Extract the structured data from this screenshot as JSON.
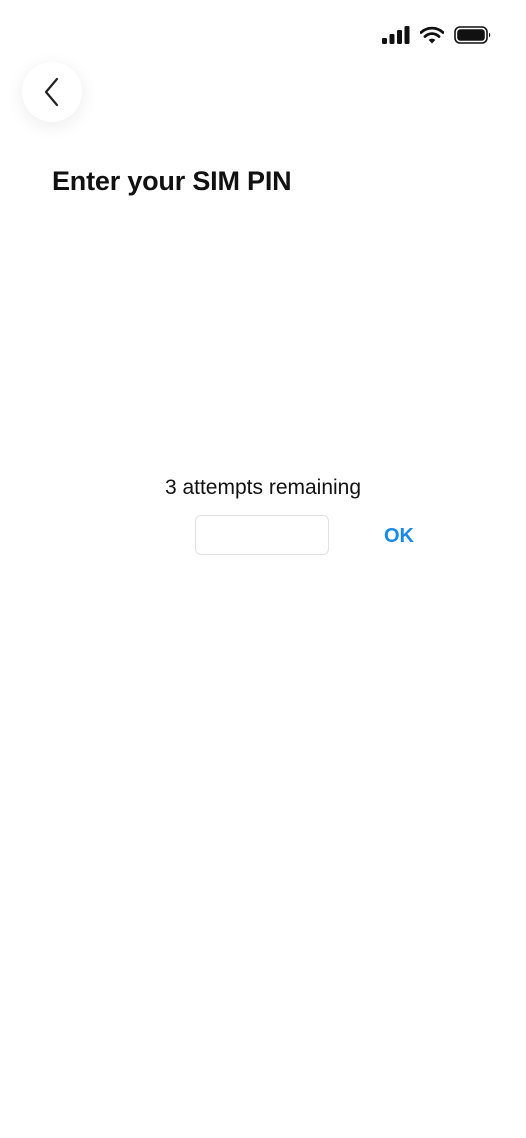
{
  "status_bar": {
    "icons": [
      "cellular-signal-icon",
      "wifi-icon",
      "battery-icon"
    ]
  },
  "header": {
    "back_icon": "chevron-left-icon",
    "title": "Enter your SIM PIN"
  },
  "pin_form": {
    "attempts_text": "3 attempts remaining",
    "pin_value": "",
    "ok_label": "OK"
  },
  "colors": {
    "accent": "#1a8ae6",
    "text": "#111111",
    "background": "#ffffff",
    "input_border": "#e2e2e2"
  }
}
